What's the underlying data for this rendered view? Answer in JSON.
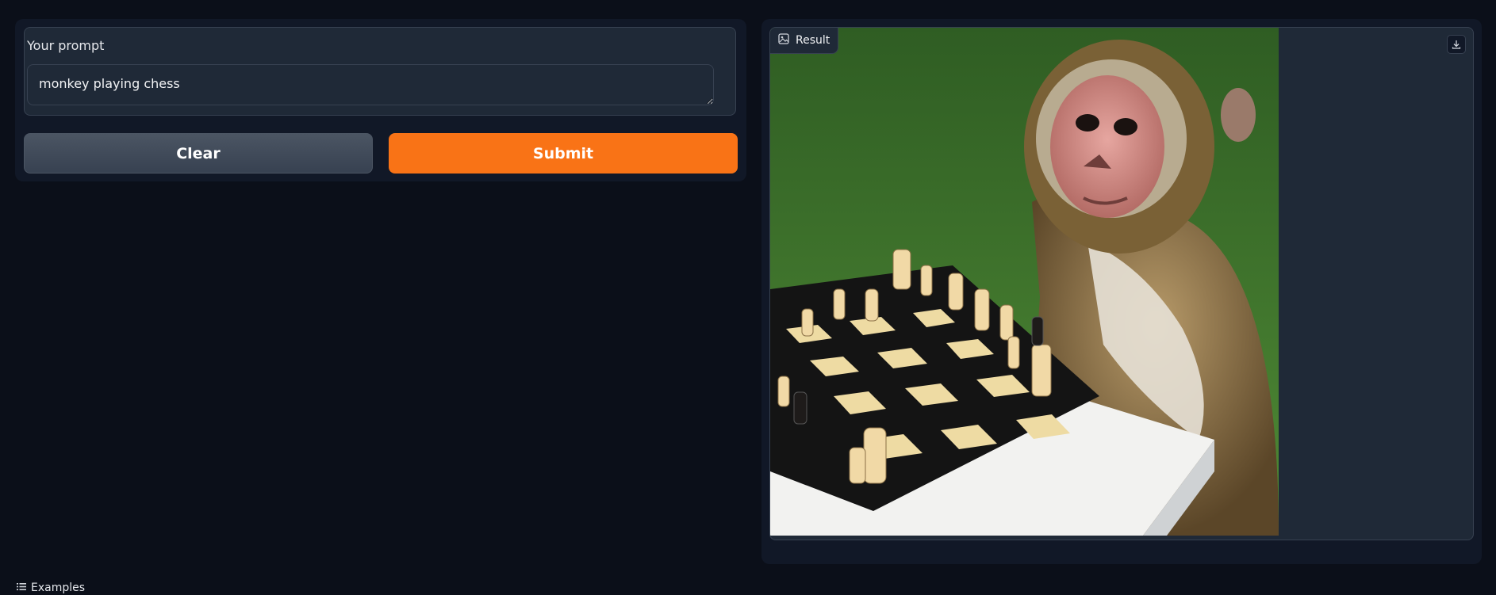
{
  "prompt": {
    "label": "Your prompt",
    "value": "monkey playing chess",
    "placeholder": ""
  },
  "buttons": {
    "clear_label": "Clear",
    "submit_label": "Submit"
  },
  "result": {
    "label": "Result",
    "image_icon": "image-icon",
    "download_icon": "download-icon"
  },
  "examples": {
    "label": "Examples",
    "icon": "list-icon"
  },
  "colors": {
    "background": "#0b0f19",
    "panel": "#111827",
    "input": "#1f2937",
    "accent": "#f97316",
    "secondary_button": "#4b5563"
  }
}
